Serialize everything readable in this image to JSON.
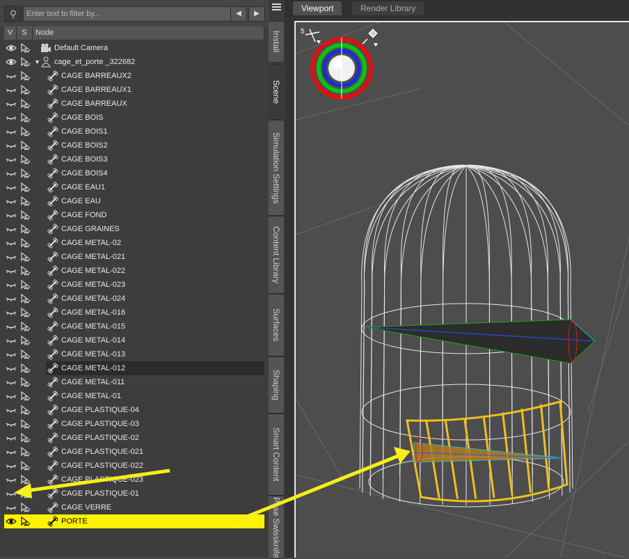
{
  "filter": {
    "placeholder": "Enter text to filter by..."
  },
  "columns": {
    "v": "V",
    "s": "S",
    "node": "Node"
  },
  "nodes": [
    {
      "label": "Default Camera",
      "type": "camera",
      "eye": "open",
      "level": 0
    },
    {
      "label": "cage_et_porte _322682",
      "type": "figure",
      "eye": "open",
      "level": 0,
      "expanded": true
    },
    {
      "label": "CAGE BARREAUX2",
      "type": "bone",
      "eye": "closed",
      "level": 1
    },
    {
      "label": "CAGE BARREAUX1",
      "type": "bone",
      "eye": "closed",
      "level": 1
    },
    {
      "label": "CAGE BARREAUX",
      "type": "bone",
      "eye": "closed",
      "level": 1
    },
    {
      "label": "CAGE BOIS",
      "type": "bone",
      "eye": "closed",
      "level": 1
    },
    {
      "label": "CAGE BOIS1",
      "type": "bone",
      "eye": "closed",
      "level": 1
    },
    {
      "label": "CAGE BOIS2",
      "type": "bone",
      "eye": "closed",
      "level": 1
    },
    {
      "label": "CAGE BOIS3",
      "type": "bone",
      "eye": "closed",
      "level": 1
    },
    {
      "label": "CAGE BOIS4",
      "type": "bone",
      "eye": "closed",
      "level": 1
    },
    {
      "label": "CAGE EAU1",
      "type": "bone",
      "eye": "closed",
      "level": 1
    },
    {
      "label": "CAGE EAU",
      "type": "bone",
      "eye": "closed",
      "level": 1
    },
    {
      "label": "CAGE FOND",
      "type": "bone",
      "eye": "closed",
      "level": 1
    },
    {
      "label": "CAGE GRAINES",
      "type": "bone",
      "eye": "closed",
      "level": 1
    },
    {
      "label": "CAGE METAL-02",
      "type": "bone",
      "eye": "closed",
      "level": 1
    },
    {
      "label": "CAGE METAL-021",
      "type": "bone",
      "eye": "closed",
      "level": 1
    },
    {
      "label": "CAGE METAL-022",
      "type": "bone",
      "eye": "closed",
      "level": 1
    },
    {
      "label": "CAGE METAL-023",
      "type": "bone",
      "eye": "closed",
      "level": 1
    },
    {
      "label": "CAGE METAL-024",
      "type": "bone",
      "eye": "closed",
      "level": 1
    },
    {
      "label": "CAGE METAL-016",
      "type": "bone",
      "eye": "closed",
      "level": 1
    },
    {
      "label": "CAGE METAL-015",
      "type": "bone",
      "eye": "closed",
      "level": 1
    },
    {
      "label": "CAGE METAL-014",
      "type": "bone",
      "eye": "closed",
      "level": 1
    },
    {
      "label": "CAGE METAL-013",
      "type": "bone",
      "eye": "closed",
      "level": 1
    },
    {
      "label": "CAGE METAL-012",
      "type": "bone",
      "eye": "closed",
      "level": 1,
      "highlight": "dark"
    },
    {
      "label": "CAGE METAL-011",
      "type": "bone",
      "eye": "closed",
      "level": 1
    },
    {
      "label": "CAGE METAL-01",
      "type": "bone",
      "eye": "closed",
      "level": 1
    },
    {
      "label": "CAGE PLASTIQUE-04",
      "type": "bone",
      "eye": "closed",
      "level": 1
    },
    {
      "label": "CAGE PLASTIQUE-03",
      "type": "bone",
      "eye": "closed",
      "level": 1
    },
    {
      "label": "CAGE PLASTIQUE-02",
      "type": "bone",
      "eye": "closed",
      "level": 1
    },
    {
      "label": "CAGE PLASTIQUE-021",
      "type": "bone",
      "eye": "closed",
      "level": 1
    },
    {
      "label": "CAGE PLASTIQUE-022",
      "type": "bone",
      "eye": "closed",
      "level": 1
    },
    {
      "label": "CAGE PLASTIQUE-023",
      "type": "bone",
      "eye": "closed",
      "level": 1
    },
    {
      "label": "CAGE PLASTIQUE-01",
      "type": "bone",
      "eye": "closed",
      "level": 1
    },
    {
      "label": "CAGE VERRE",
      "type": "bone",
      "eye": "closed",
      "level": 1
    },
    {
      "label": "PORTE",
      "type": "bone",
      "eye": "open",
      "level": 1,
      "highlight": "yellow"
    }
  ],
  "side_tabs": [
    {
      "label": "Install",
      "active": false
    },
    {
      "label": "Scene",
      "active": true
    },
    {
      "label": "Simulation Settings",
      "active": false
    },
    {
      "label": "Content Library",
      "active": false
    },
    {
      "label": "Surfaces",
      "active": false
    },
    {
      "label": "Shaping",
      "active": false
    },
    {
      "label": "Smart Content",
      "active": false
    },
    {
      "label": "Pose Swissknife",
      "active": false
    }
  ],
  "viewport_tabs": [
    {
      "label": "Viewport",
      "active": true
    },
    {
      "label": "Render Library",
      "active": false
    }
  ],
  "viewport": {
    "corner_label": "5"
  },
  "colors": {
    "highlight_yellow": "#fff200",
    "annotation_arrow": "#f5ef1a",
    "cage_wire": "#e8e8e8",
    "door_wire": "#f0c020"
  }
}
